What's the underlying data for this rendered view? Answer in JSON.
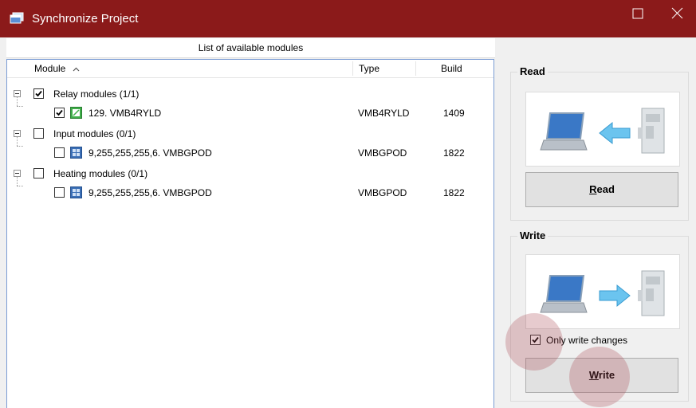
{
  "window": {
    "title": "Synchronize Project",
    "titlebar_color": "#8b1a1a",
    "maximize_icon": "maximize-icon",
    "close_icon": "close-icon"
  },
  "list_header": "List of available modules",
  "columns": {
    "module": "Module",
    "type": "Type",
    "build": "Build"
  },
  "tree": [
    {
      "label": "Relay modules (1/1)",
      "checked": true,
      "child": {
        "label": "129. VMB4RYLD",
        "type": "VMB4RYLD",
        "build": "1409",
        "checked": true,
        "icon": "relay-module-icon"
      }
    },
    {
      "label": "Input modules (0/1)",
      "checked": false,
      "child": {
        "label": "9,255,255,255,6. VMBGPOD",
        "type": "VMBGPOD",
        "build": "1822",
        "checked": false,
        "icon": "glass-panel-module-icon"
      }
    },
    {
      "label": "Heating modules (0/1)",
      "checked": false,
      "child": {
        "label": "9,255,255,255,6. VMBGPOD",
        "type": "VMBGPOD",
        "build": "1822",
        "checked": false,
        "icon": "glass-panel-module-icon"
      }
    }
  ],
  "read": {
    "group_title": "Read",
    "button_mnemonic": "R",
    "button_rest": "ead"
  },
  "write": {
    "group_title": "Write",
    "only_changes_label": "Only write changes",
    "only_changes_checked": true,
    "button_mnemonic": "W",
    "button_rest": "rite"
  }
}
